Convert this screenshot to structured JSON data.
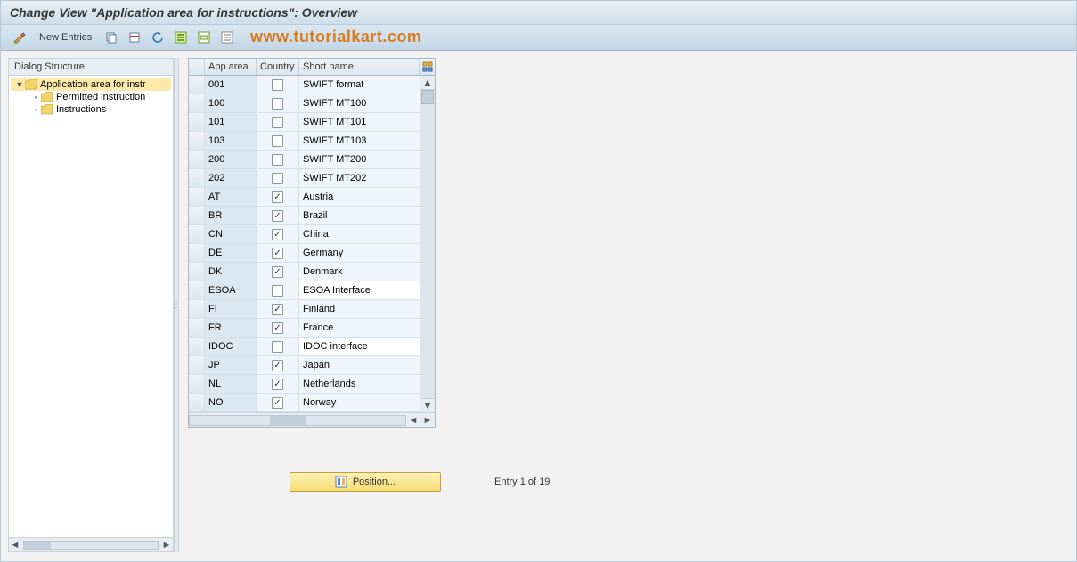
{
  "title": "Change View \"Application area for instructions\": Overview",
  "toolbar": {
    "new_entries_label": "New Entries"
  },
  "watermark": "www.tutorialkart.com",
  "sidebar": {
    "header": "Dialog Structure",
    "items": [
      {
        "label": "Application area for instr",
        "level": 0,
        "open": true,
        "selected": true
      },
      {
        "label": "Permitted instruction",
        "level": 1,
        "open": false,
        "selected": false
      },
      {
        "label": "Instructions",
        "level": 1,
        "open": false,
        "selected": false
      }
    ]
  },
  "table": {
    "columns": {
      "apparea": "App.area",
      "country": "Country",
      "shortname": "Short name"
    },
    "rows": [
      {
        "apparea": "001",
        "country": false,
        "shortname": "SWIFT format",
        "white": false
      },
      {
        "apparea": "100",
        "country": false,
        "shortname": "SWIFT MT100",
        "white": false
      },
      {
        "apparea": "101",
        "country": false,
        "shortname": "SWIFT MT101",
        "white": false
      },
      {
        "apparea": "103",
        "country": false,
        "shortname": "SWIFT MT103",
        "white": false
      },
      {
        "apparea": "200",
        "country": false,
        "shortname": "SWIFT MT200",
        "white": false
      },
      {
        "apparea": "202",
        "country": false,
        "shortname": "SWIFT MT202",
        "white": false
      },
      {
        "apparea": "AT",
        "country": true,
        "shortname": "Austria",
        "white": false
      },
      {
        "apparea": "BR",
        "country": true,
        "shortname": "Brazil",
        "white": false
      },
      {
        "apparea": "CN",
        "country": true,
        "shortname": "China",
        "white": false
      },
      {
        "apparea": "DE",
        "country": true,
        "shortname": "Germany",
        "white": false
      },
      {
        "apparea": "DK",
        "country": true,
        "shortname": "Denmark",
        "white": false
      },
      {
        "apparea": "ESOA",
        "country": false,
        "shortname": "ESOA Interface",
        "white": true
      },
      {
        "apparea": "FI",
        "country": true,
        "shortname": "Finland",
        "white": false
      },
      {
        "apparea": "FR",
        "country": true,
        "shortname": "France",
        "white": false
      },
      {
        "apparea": "IDOC",
        "country": false,
        "shortname": "IDOC interface",
        "white": true
      },
      {
        "apparea": "JP",
        "country": true,
        "shortname": "Japan",
        "white": false
      },
      {
        "apparea": "NL",
        "country": true,
        "shortname": "Netherlands",
        "white": false
      },
      {
        "apparea": "NO",
        "country": true,
        "shortname": "Norway",
        "white": false
      }
    ]
  },
  "footer": {
    "position_label": "Position...",
    "entry_status": "Entry 1 of 19"
  }
}
